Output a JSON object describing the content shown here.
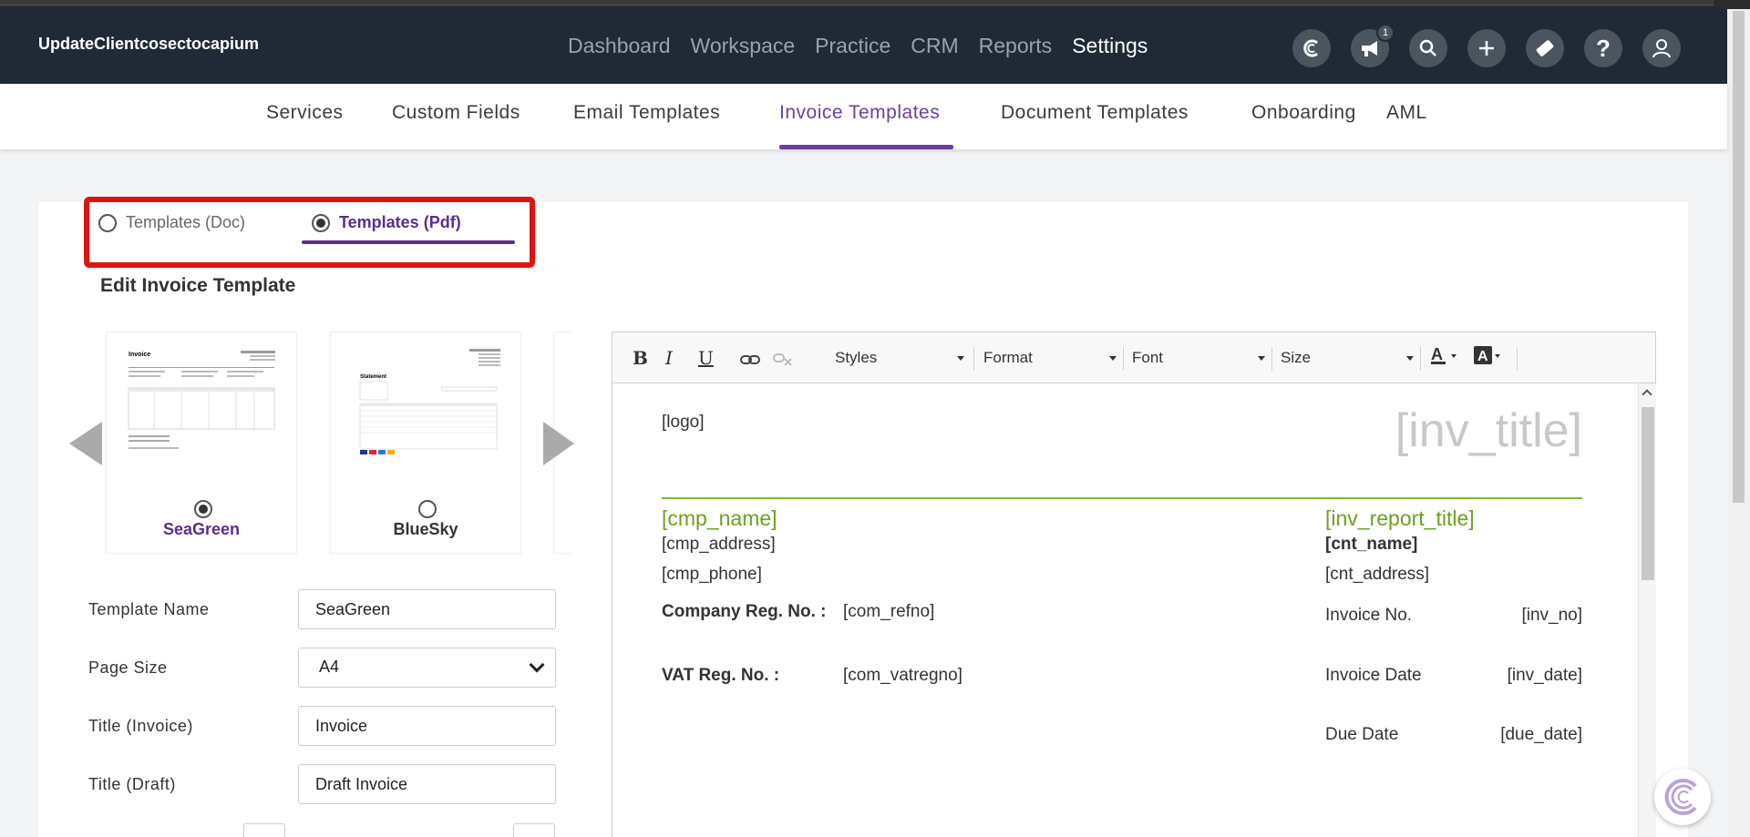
{
  "app": {
    "brand": "UpdateClientcosectocapium"
  },
  "main_nav": [
    {
      "label": "Dashboard",
      "active": false
    },
    {
      "label": "Workspace",
      "active": false
    },
    {
      "label": "Practice",
      "active": false
    },
    {
      "label": "CRM",
      "active": false
    },
    {
      "label": "Reports",
      "active": false
    },
    {
      "label": "Settings",
      "active": true
    }
  ],
  "header_icons": [
    {
      "icon": "capium-logo-icon"
    },
    {
      "icon": "megaphone-icon",
      "badge": "1"
    },
    {
      "icon": "search-icon"
    },
    {
      "icon": "plus-icon"
    },
    {
      "icon": "ticket-icon"
    },
    {
      "icon": "help-icon"
    },
    {
      "icon": "user-icon"
    }
  ],
  "sub_nav": [
    {
      "label": "Services"
    },
    {
      "label": "Custom Fields"
    },
    {
      "label": "Email Templates"
    },
    {
      "label": "Invoice Templates",
      "active": true
    },
    {
      "label": "Document Templates"
    },
    {
      "label": "Onboarding"
    },
    {
      "label": "AML"
    }
  ],
  "template_type": {
    "doc_label": "Templates (Doc)",
    "pdf_label": "Templates (Pdf)",
    "selected": "pdf"
  },
  "section_title": "Edit Invoice Template",
  "templates": [
    {
      "name": "SeaGreen",
      "selected": true
    },
    {
      "name": "BlueSky",
      "selected": false
    }
  ],
  "form": {
    "template_name_label": "Template Name",
    "template_name_value": "SeaGreen",
    "page_size_label": "Page Size",
    "page_size_value": "A4",
    "title_invoice_label": "Title (Invoice)",
    "title_invoice_value": "Invoice",
    "title_draft_label": "Title (Draft)",
    "title_draft_value": "Draft Invoice"
  },
  "toolbar": {
    "styles": "Styles",
    "format": "Format",
    "font": "Font",
    "size": "Size"
  },
  "document": {
    "logo": "[logo]",
    "inv_title": "[inv_title]",
    "cmp_name": "[cmp_name]",
    "cmp_address": "[cmp_address]",
    "cmp_phone": "[cmp_phone]",
    "company_reg_label": "Company Reg. No. :",
    "com_refno": "[com_refno]",
    "vat_reg_label": "VAT Reg. No. :",
    "com_vatregno": "[com_vatregno]",
    "inv_report_title": "[inv_report_title]",
    "cnt_name": "[cnt_name]",
    "cnt_address": "[cnt_address]",
    "invoice_no_label": "Invoice No.",
    "inv_no": "[inv_no]",
    "invoice_date_label": "Invoice Date",
    "inv_date": "[inv_date]",
    "due_date_label": "Due Date",
    "due_date": "[due_date]"
  },
  "colors": {
    "header_bg": "#1f2a36",
    "accent_purple": "#6b3fa0",
    "highlight_red": "#e0140f",
    "template_green": "#6aa121"
  }
}
